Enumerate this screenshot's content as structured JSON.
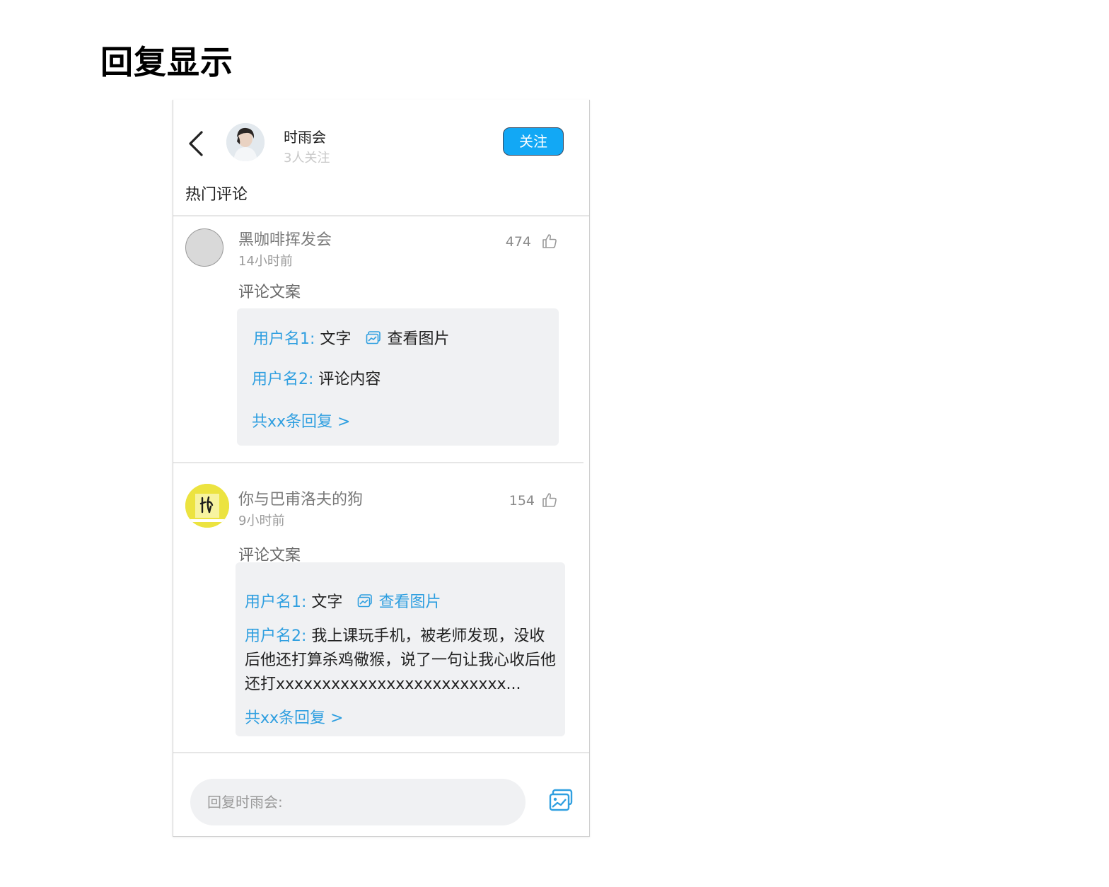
{
  "page": {
    "title": "回复显示"
  },
  "header": {
    "name": "时雨会",
    "followers": "3人关注",
    "follow_label": "关注",
    "section_title": "热门评论"
  },
  "comments": [
    {
      "user": "黑咖啡挥发会",
      "time": "14小时前",
      "likes": "474",
      "text": "评论文案",
      "replies": [
        {
          "user": "用户名1:",
          "text": "文字",
          "view_image": "查看图片"
        },
        {
          "user": "用户名2:",
          "text": "评论内容"
        }
      ],
      "more": "共xx条回复 >"
    },
    {
      "user": "你与巴甫洛夫的狗",
      "time": "9小时前",
      "likes": "154",
      "text": "评论文案",
      "replies": [
        {
          "user": "用户名1:",
          "text": "文字",
          "view_image": "查看图片"
        },
        {
          "user": "用户名2:",
          "text": "我上课玩手机，被老师发现，没收后他还打算杀鸡儆猴，说了一句让我心收后他还打xxxxxxxxxxxxxxxxxxxxxxxxx..."
        }
      ],
      "more": "共xx条回复 >"
    }
  ],
  "input": {
    "placeholder": "回复时雨会:"
  },
  "icons": {
    "back": "chevron-left-icon",
    "like": "thumbs-up-icon",
    "image": "image-icon"
  },
  "colors": {
    "accent": "#12a8f5",
    "link": "#2f9fe0",
    "reply_bg": "#f0f1f3"
  }
}
